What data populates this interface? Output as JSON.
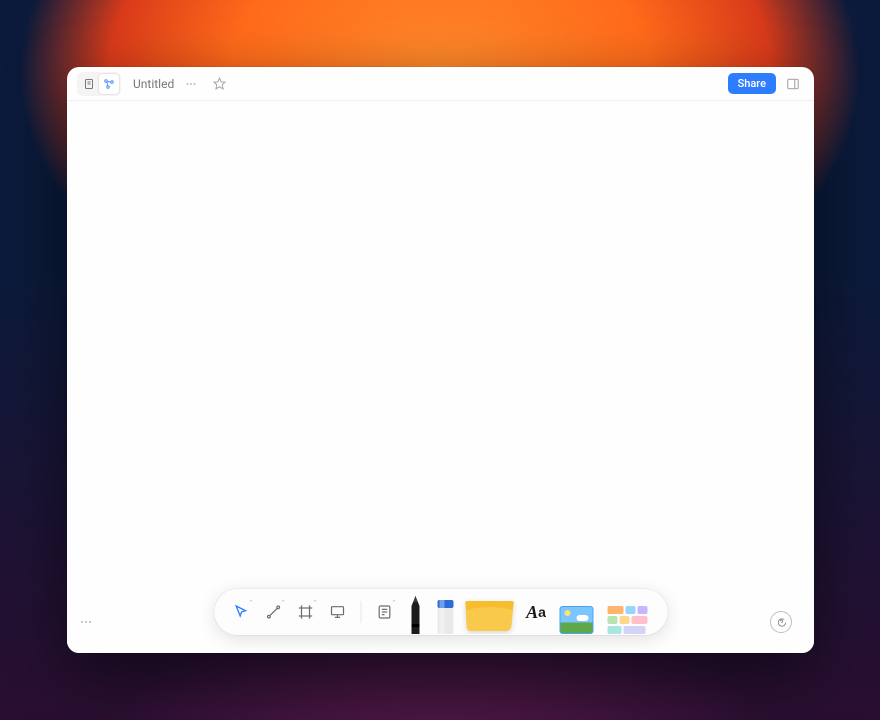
{
  "header": {
    "title": "Untitled",
    "share_label": "Share"
  },
  "toolbar": {
    "text_tool_label_big": "A",
    "text_tool_label_small": "a"
  },
  "colors": {
    "accent": "#2f7dff",
    "note_yellow": "#f8c94a",
    "highlighter_blue": "#2d6bd6"
  }
}
